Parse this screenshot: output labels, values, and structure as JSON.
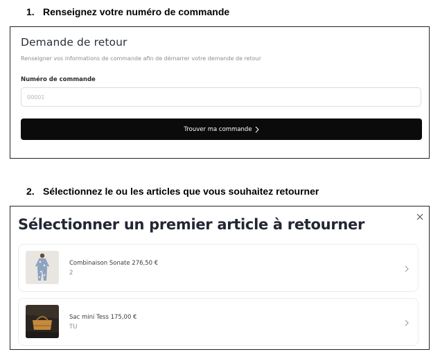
{
  "steps": {
    "step1": {
      "number": "1.",
      "text": "Renseignez votre numéro de commande"
    },
    "step2": {
      "number": "2.",
      "text": "Sélectionnez le ou les articles que vous souhaitez retourner"
    }
  },
  "return_form": {
    "title": "Demande de retour",
    "subtitle": "Renseigner vos informations de commande afin de démarrer votre demande de retour",
    "order_label": "Numéro de commande",
    "order_placeholder": "00001",
    "order_value": "",
    "submit_label": "Trouver ma commande"
  },
  "article_picker": {
    "title": "Sélectionner un premier article à retourner",
    "items": [
      {
        "name": "Combinaison Sonate 276,50 €",
        "variant": "2",
        "thumbnail": "jumpsuit-image"
      },
      {
        "name": "Sac mini Tess 175,00 €",
        "variant": "TU",
        "thumbnail": "bag-image"
      }
    ]
  },
  "icons": {
    "submit_chevron": "chevron-right-icon",
    "close": "close-icon",
    "item_chevron": "chevron-right-icon"
  },
  "colors": {
    "button_bg": "#0b0b0b",
    "button_text": "#ffffff",
    "panel_border": "#222222",
    "card_border": "#ececec"
  }
}
